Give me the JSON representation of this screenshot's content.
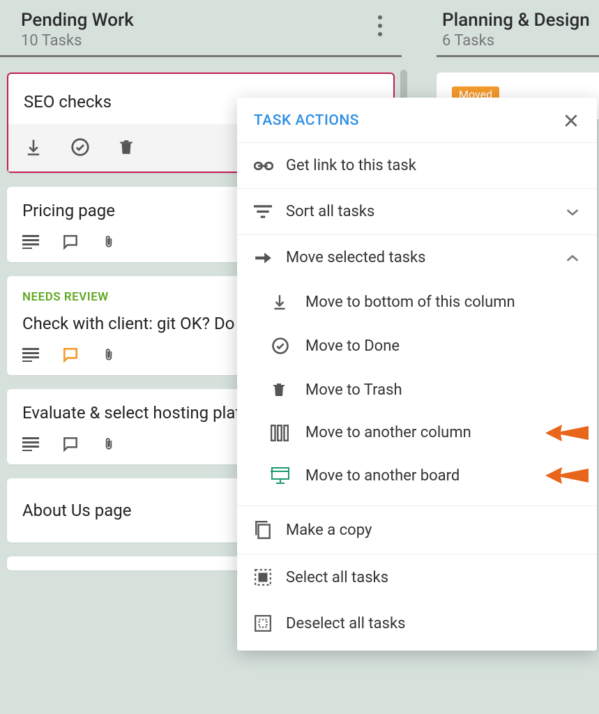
{
  "columns": {
    "pending": {
      "title": "Pending Work",
      "subtitle": "10 Tasks"
    },
    "planning": {
      "title": "Planning & Design",
      "subtitle": "6 Tasks"
    }
  },
  "cards": {
    "seo": {
      "title": "SEO checks"
    },
    "pricing": {
      "title": "Pricing page"
    },
    "client": {
      "tag": "NEEDS REVIEW",
      "title": "Check with client: git OK? Do t"
    },
    "hosting": {
      "title": "Evaluate & select hosting plat"
    },
    "about": {
      "title": "About Us page"
    },
    "moved_badge": "Moved"
  },
  "popup": {
    "title": "TASK ACTIONS",
    "get_link": "Get link to this task",
    "sort": "Sort all tasks",
    "move": "Move selected tasks",
    "move_bottom": "Move to bottom of this column",
    "move_done": "Move to Done",
    "move_trash": "Move to Trash",
    "move_column": "Move to another column",
    "move_board": "Move to another board",
    "copy": "Make a copy",
    "select_all": "Select all tasks",
    "deselect_all": "Deselect all tasks"
  }
}
